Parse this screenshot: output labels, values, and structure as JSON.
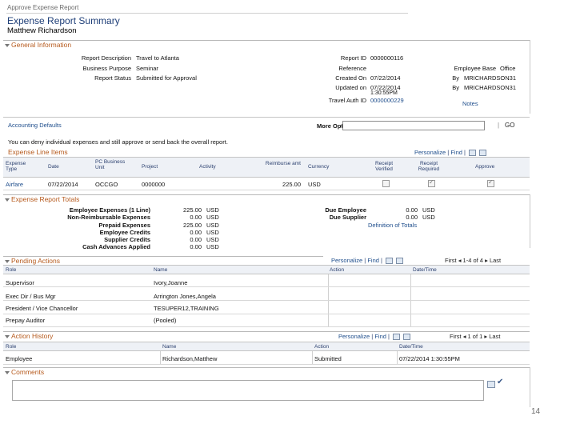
{
  "page": {
    "breadcrumb": "Approve Expense Report",
    "title": "Expense Report Summary",
    "employee_name": "Matthew Richardson",
    "slide_number": "14"
  },
  "general": {
    "header": "General Information",
    "labels": {
      "report_description": "Report Description",
      "business_purpose": "Business Purpose",
      "report_status": "Report Status",
      "report_id": "Report ID",
      "reference": "Reference",
      "created_on": "Created On",
      "updated_on": "Updated on",
      "travel_auth_id": "Travel Auth ID",
      "employee_base": "Employee Base",
      "by1": "By",
      "by2": "By"
    },
    "values": {
      "report_description": "Travel to Atlanta",
      "business_purpose": "Seminar",
      "report_status": "Submitted for Approval",
      "report_id": "0000000116",
      "created_on": "07/22/2014",
      "updated_on": "07/22/2014",
      "updated_time": "1:30:55PM",
      "travel_auth_id": "0000000229",
      "employee_base": "Office",
      "by1": "MRICHARDSON31",
      "by2": "MRICHARDSON31"
    },
    "notes_link": "Notes"
  },
  "accounting": {
    "link": "Accounting Defaults",
    "more_options_label": "More Options",
    "go_button": "GO",
    "instruction": "You can deny individual expenses and still approve or send back the overall report."
  },
  "expense_lines": {
    "header": "Expense Line Items",
    "toolbar": {
      "personalize": "Personalize",
      "find": "Find"
    },
    "columns": [
      "Expense Type",
      "Date",
      "PC Business Unit",
      "Project",
      "Activity",
      "Reimburse amt",
      "Currency",
      "Receipt Verified",
      "Receipt Required",
      "Approve"
    ],
    "rows": [
      {
        "type": "Airfare",
        "date": "07/22/2014",
        "bu": "OCCGO",
        "project": "0000000",
        "activity": "",
        "amount": "225.00",
        "currency": "USD"
      }
    ]
  },
  "totals": {
    "header": "Expense Report Totals",
    "left": [
      {
        "label": "Employee Expenses (1 Line)",
        "amount": "225.00",
        "currency": "USD"
      },
      {
        "label": "Non-Reimbursable Expenses",
        "amount": "0.00",
        "currency": "USD"
      },
      {
        "label": "Prepaid Expenses",
        "amount": "225.00",
        "currency": "USD"
      },
      {
        "label": "Employee Credits",
        "amount": "0.00",
        "currency": "USD"
      },
      {
        "label": "Supplier Credits",
        "amount": "0.00",
        "currency": "USD"
      },
      {
        "label": "Cash Advances Applied",
        "amount": "0.00",
        "currency": "USD"
      }
    ],
    "right": [
      {
        "label": "Due Employee",
        "amount": "0.00",
        "currency": "USD"
      },
      {
        "label": "Due Supplier",
        "amount": "0.00",
        "currency": "USD"
      }
    ],
    "definition_link": "Definition of Totals"
  },
  "pending": {
    "header": "Pending Actions",
    "toolbar": {
      "personalize": "Personalize",
      "find": "Find",
      "first": "First",
      "range": "1-4 of 4",
      "last": "Last"
    },
    "columns": [
      "Role",
      "Name",
      "Action",
      "Date/Time"
    ],
    "rows": [
      {
        "role": "Supervisor",
        "name": "Ivory,Joanne"
      },
      {
        "role": "Exec Dir / Bus Mgr",
        "name": "Arrington Jones,Angela"
      },
      {
        "role": "President / Vice Chancellor",
        "name": "TESUPER12,TRAINING"
      },
      {
        "role": "Prepay Auditor",
        "name": "(Pooled)"
      }
    ]
  },
  "history": {
    "header": "Action History",
    "toolbar": {
      "personalize": "Personalize",
      "find": "Find",
      "first": "First",
      "range": "1 of 1",
      "last": "Last"
    },
    "columns": [
      "Role",
      "Name",
      "Action",
      "Date/Time"
    ],
    "rows": [
      {
        "role": "Employee",
        "name": "Richardson,Matthew",
        "action": "Submitted",
        "datetime": "07/22/2014 1:30:55PM"
      }
    ]
  },
  "comments": {
    "header": "Comments",
    "value": ""
  }
}
